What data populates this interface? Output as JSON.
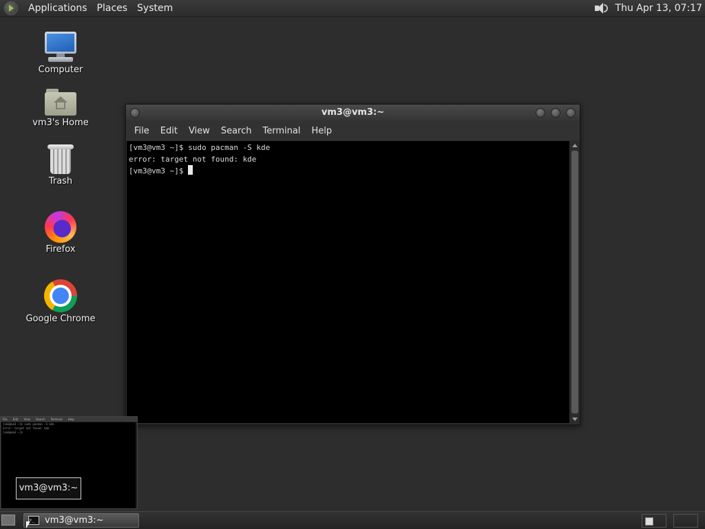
{
  "top_panel": {
    "menus": [
      "Applications",
      "Places",
      "System"
    ],
    "clock": "Thu Apr 13, 07:17",
    "icons": {
      "logo": "distro-logo-icon",
      "volume": "speaker-icon"
    }
  },
  "desktop": {
    "icons": [
      {
        "label": "Computer",
        "icon": "computer-icon"
      },
      {
        "label": "vm3's Home",
        "icon": "home-folder-icon"
      },
      {
        "label": "Trash",
        "icon": "trash-icon"
      },
      {
        "label": "Firefox",
        "icon": "firefox-icon"
      },
      {
        "label": "Google Chrome",
        "icon": "chrome-icon"
      }
    ]
  },
  "terminal": {
    "title": "vm3@vm3:~",
    "menu": [
      "File",
      "Edit",
      "View",
      "Search",
      "Terminal",
      "Help"
    ],
    "lines": [
      "[vm3@vm3 ~]$ sudo pacman -S kde",
      "error: target not found: kde",
      "[vm3@vm3 ~]$ "
    ]
  },
  "preview": {
    "label": "vm3@vm3:~",
    "menu": [
      "File",
      "Edit",
      "View",
      "Search",
      "Terminal",
      "Help"
    ],
    "lines": [
      "[vm3@vm3 ~]$ sudo pacman -S kde",
      "error: target not found: kde",
      "[vm3@vm3 ~]$ "
    ]
  },
  "taskbar": {
    "window_label": "vm3@vm3:~",
    "workspaces": 2
  }
}
